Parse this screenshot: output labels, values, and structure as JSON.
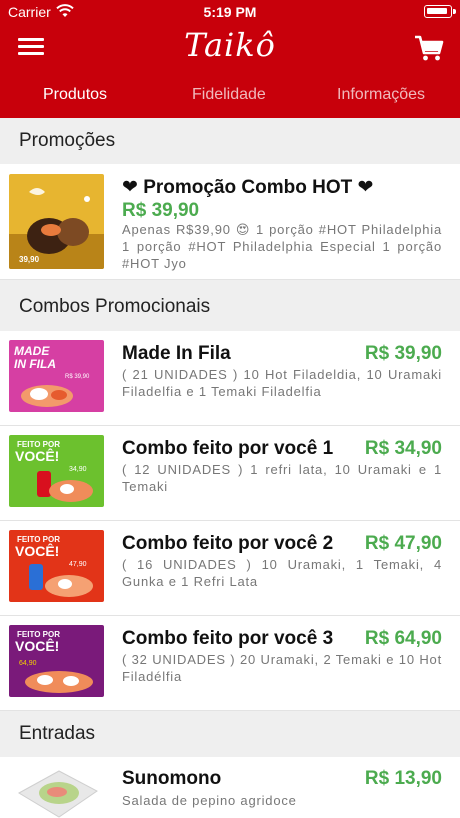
{
  "status_bar": {
    "carrier": "Carrier",
    "time": "5:19 PM"
  },
  "header": {
    "logo": "Taikô"
  },
  "tabs": [
    {
      "label": "Produtos",
      "active": true
    },
    {
      "label": "Fidelidade",
      "active": false
    },
    {
      "label": "Informações",
      "active": false
    }
  ],
  "sections": {
    "promo": {
      "title": "Promoções",
      "item": {
        "title": "❤ Promoção Combo HOT ❤",
        "price": "R$ 39,90",
        "description": "Apenas R$39,90 😍 1 porção #HOT Philadelphia 1 porção #HOT Philadelphia Especial 1 porção #HOT Jyo"
      }
    },
    "combos": {
      "title": "Combos Promocionais",
      "items": [
        {
          "title": "Made In Fila",
          "price": "R$ 39,90",
          "description": "( 21 UNIDADES ) 10 Hot Filadeldia, 10 Uramaki Filadelfia e 1 Temaki Filadelfia"
        },
        {
          "title": "Combo feito por você 1",
          "price": "R$ 34,90",
          "description": "( 12 UNIDADES ) 1 refri lata, 10 Uramaki e 1 Temaki"
        },
        {
          "title": "Combo feito por você 2",
          "price": "R$ 47,90",
          "description": "( 16 UNIDADES ) 10 Uramaki, 1 Temaki, 4 Gunka e 1 Refri Lata"
        },
        {
          "title": "Combo feito por você 3",
          "price": "R$ 64,90",
          "description": "( 32 UNIDADES ) 20 Uramaki, 2 Temaki e 10 Hot Filadélfia"
        }
      ]
    },
    "entradas": {
      "title": "Entradas",
      "items": [
        {
          "title": "Sunomono",
          "price": "R$ 13,90",
          "description": "Salada de pepino agridoce"
        }
      ]
    }
  },
  "thumb_text": {
    "promo_price": "39,90",
    "made_in": "MADE",
    "in_fila": "IN FILA",
    "fila_price": "R$ 39,90",
    "feito_por": "FEITO POR",
    "voce": "VOCÊ!",
    "price1": "34,90",
    "price2": "47,90",
    "price3": "64,90"
  },
  "colors": {
    "brand_red": "#c8000b",
    "price_green": "#4cab4f",
    "background": "#efefef"
  },
  "icons": {
    "menu": "hamburger-menu-icon",
    "cart": "shopping-cart-icon"
  }
}
